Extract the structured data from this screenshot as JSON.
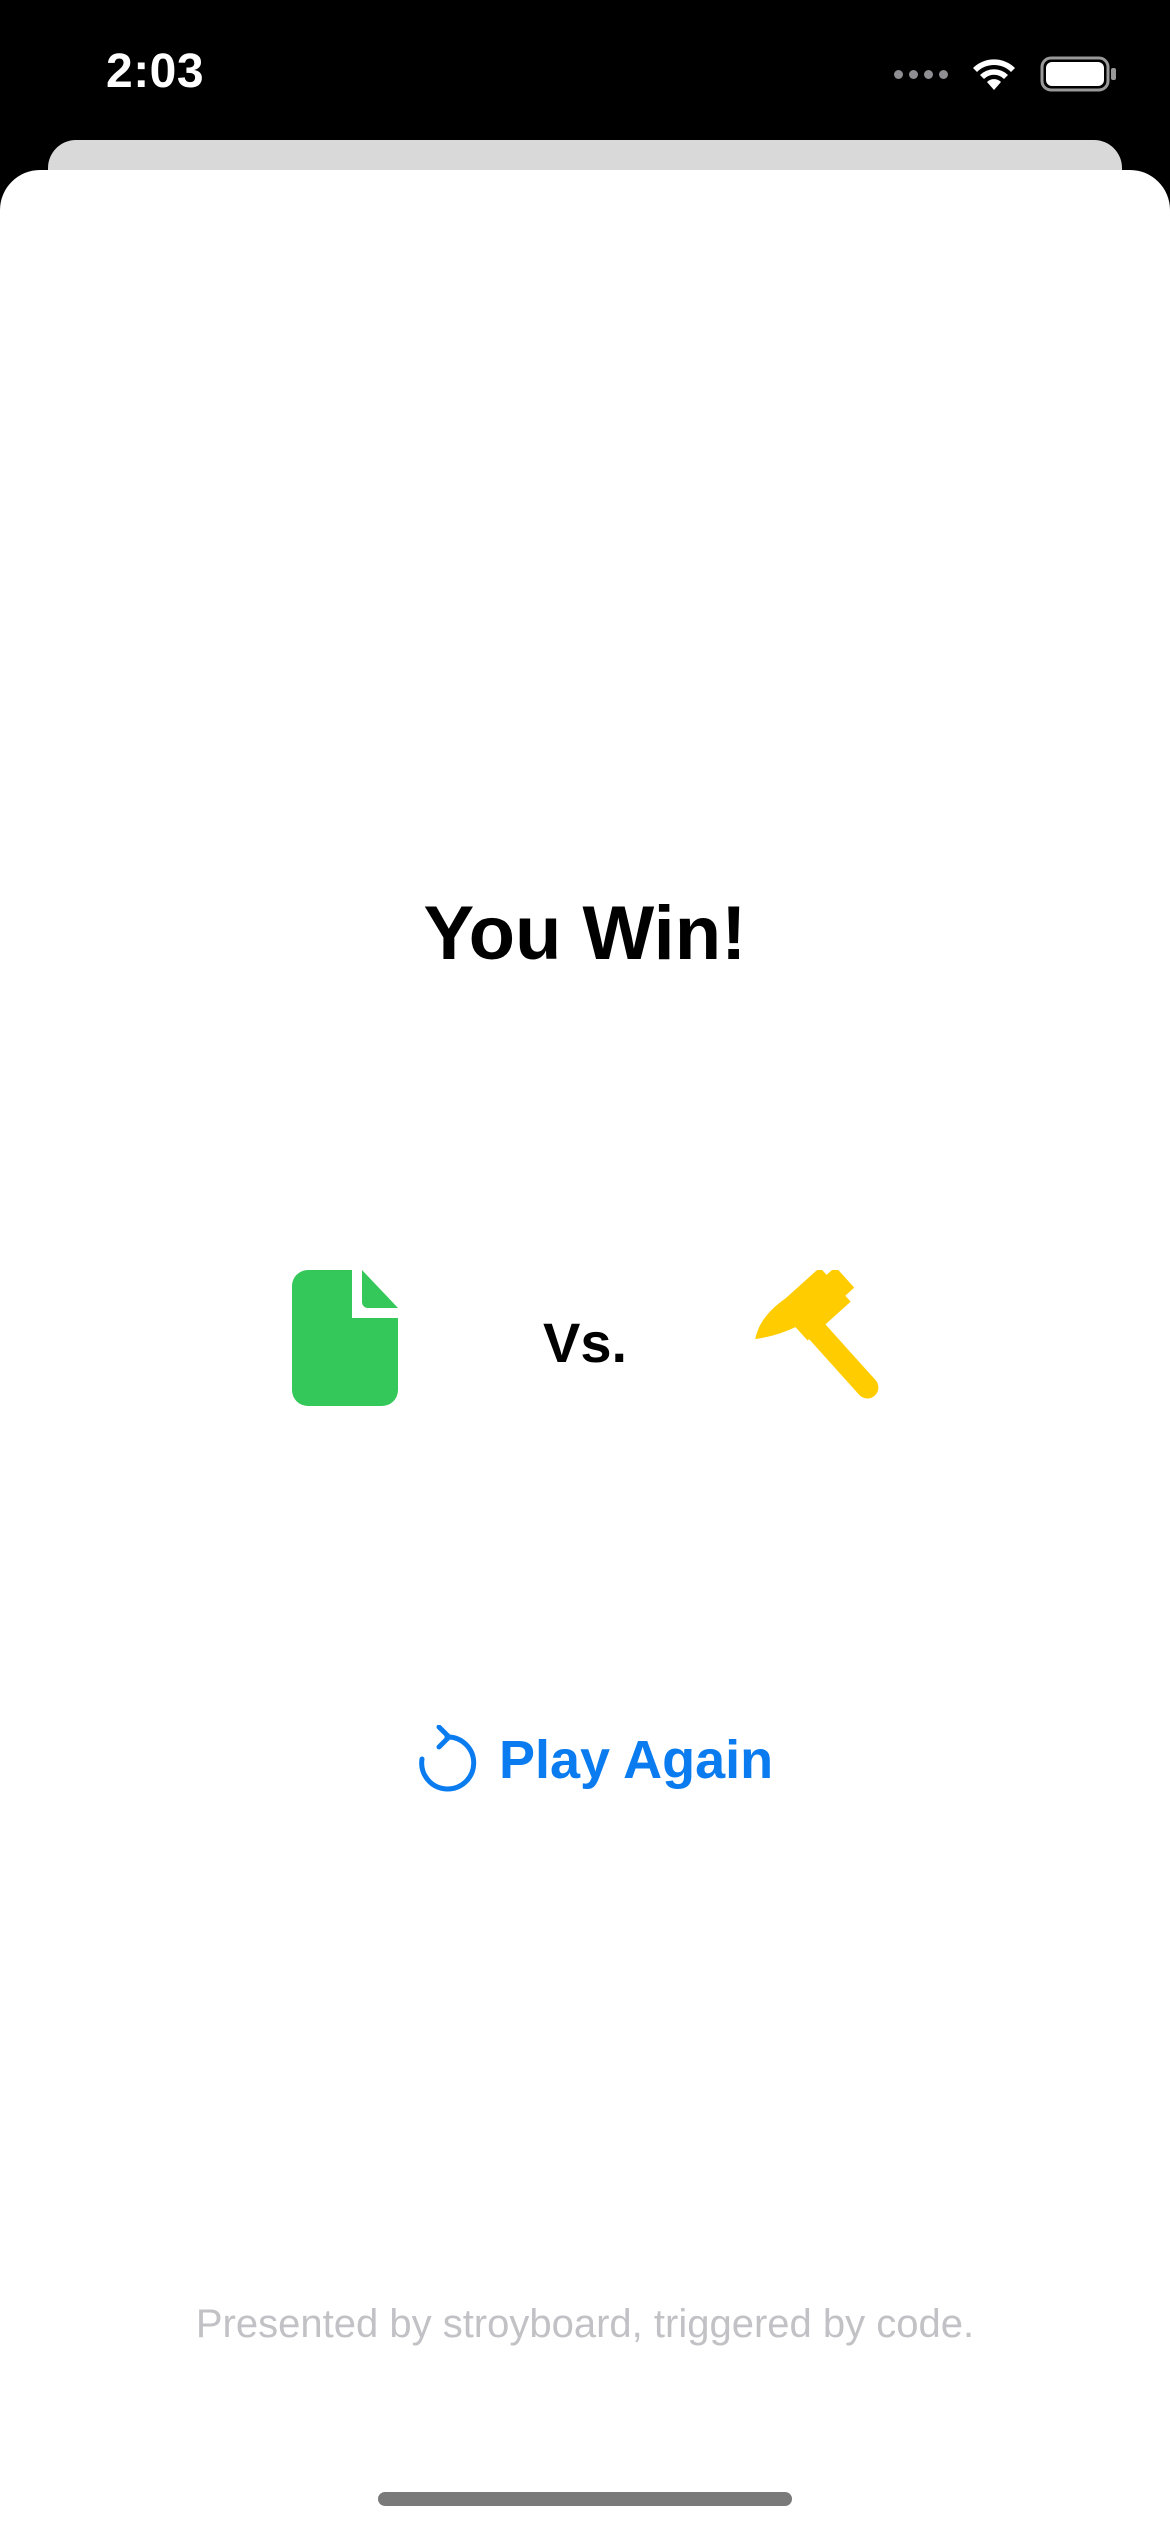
{
  "status_bar": {
    "time": "2:03",
    "icons": [
      "cellular-signal-icon",
      "wifi-icon",
      "battery-icon"
    ]
  },
  "result": {
    "title": "You Win!"
  },
  "matchup": {
    "player_choice_icon": "document-icon",
    "vs_label": "Vs.",
    "opponent_choice_icon": "hammer-icon"
  },
  "actions": {
    "play_again_icon": "refresh-icon",
    "play_again_label": "Play Again"
  },
  "footer": {
    "note": "Presented by stroyboard, triggered by code."
  },
  "colors": {
    "accent": "#0a7cf0",
    "document_green": "#34c759",
    "hammer_yellow": "#ffcc00",
    "footer_text": "#c2c2c6"
  }
}
